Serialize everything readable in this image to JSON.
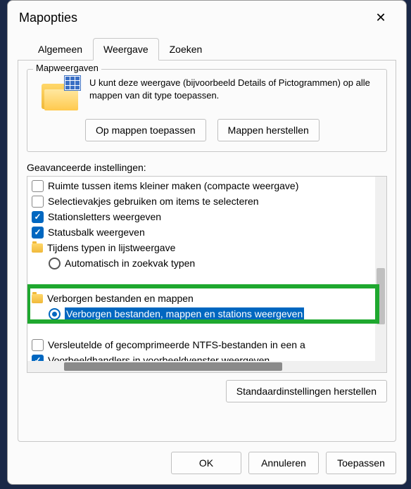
{
  "title": "Mapopties",
  "tabs": {
    "general": "Algemeen",
    "view": "Weergave",
    "search": "Zoeken"
  },
  "folderViews": {
    "groupTitle": "Mapweergaven",
    "description": "U kunt deze weergave (bijvoorbeeld Details of Pictogrammen) op alle mappen van dit type toepassen.",
    "applyBtn": "Op mappen toepassen",
    "resetBtn": "Mappen herstellen"
  },
  "advanced": {
    "label": "Geavanceerde instellingen:",
    "items": {
      "compact": "Ruimte tussen items kleiner maken (compacte weergave)",
      "selectCheckboxes": "Selectievakjes gebruiken om items te selecteren",
      "driveLetters": "Stationsletters weergeven",
      "statusBar": "Statusbalk weergeven",
      "typingGroup": "Tijdens typen in lijstweergave",
      "typingAuto": "Automatisch in zoekvak typen",
      "hiddenGroup": "Verborgen bestanden en mappen",
      "hiddenShow": "Verborgen bestanden, mappen en stations weergeven",
      "ntfs": "Versleutelde of gecomprimeerde NTFS-bestanden in een a",
      "preview": "Voorbeeldhandlers in voorbeeldvenster weergeven"
    },
    "restoreBtn": "Standaardinstellingen herstellen"
  },
  "buttons": {
    "ok": "OK",
    "cancel": "Annuleren",
    "apply": "Toepassen"
  }
}
